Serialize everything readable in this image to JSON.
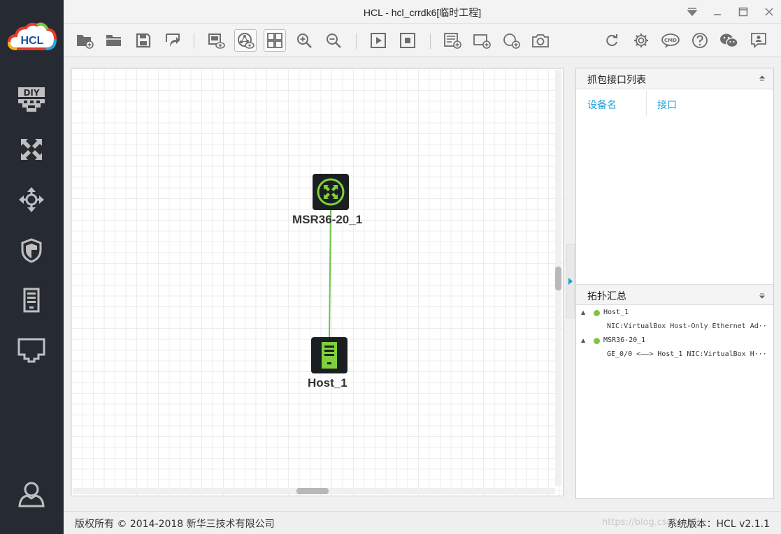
{
  "app": {
    "logo_text": "HCL",
    "window_title": "HCL - hcl_crrdk6[临时工程]"
  },
  "sidebar": {
    "items": [
      {
        "name": "diy",
        "label": "DIY"
      },
      {
        "name": "router"
      },
      {
        "name": "switch"
      },
      {
        "name": "firewall"
      },
      {
        "name": "host"
      },
      {
        "name": "cable"
      }
    ]
  },
  "toolbar": {
    "cmd_label": "CMD"
  },
  "canvas": {
    "devices": [
      {
        "label": "MSR36-20_1",
        "type": "router"
      },
      {
        "label": "Host_1",
        "type": "host"
      }
    ],
    "link_color": "#6cc24a"
  },
  "capture_panel": {
    "title": "抓包接口列表",
    "col_device": "设备名",
    "col_interface": "接口"
  },
  "topology_panel": {
    "title": "拓扑汇总",
    "nodes": [
      {
        "name": "Host_1",
        "detail": "NIC:VirtualBox Host-Only Ethernet Ad···"
      },
      {
        "name": "MSR36-20_1",
        "detail": "GE_0/0 <——> Host_1 NIC:VirtualBox H···"
      }
    ]
  },
  "status": {
    "copyright": "版权所有 © 2014-2018 新华三技术有限公司",
    "watermark": "https://blog.csdn.net/",
    "version": "系统版本：HCL v2.1.1"
  },
  "colors": {
    "sidebar_bg": "#262b33",
    "accent_green": "#84c341",
    "link_blue": "#1a9fd8"
  }
}
